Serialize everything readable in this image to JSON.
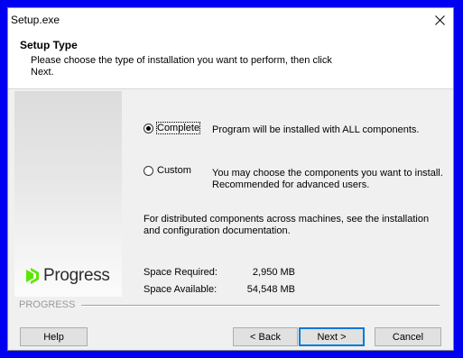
{
  "window": {
    "title": "Setup.exe"
  },
  "header": {
    "title": "Setup Type",
    "description": "Please choose the type of installation you want to perform, then click Next."
  },
  "banner": {
    "logo_text": "Progress"
  },
  "options": [
    {
      "label": "Complete",
      "selected": true,
      "description": "Program will be installed with  ALL components."
    },
    {
      "label": "Custom",
      "selected": false,
      "description": "You may choose the components you want to install. Recommended for advanced users."
    }
  ],
  "info": "For distributed components across machines, see the installation and configuration documentation.",
  "space": {
    "required_label": "Space Required:",
    "required_value": "2,950 MB",
    "available_label": "Space Available:",
    "available_value": "54,548 MB"
  },
  "footer": {
    "brand": "PROGRESS"
  },
  "buttons": {
    "help": "Help",
    "back": "< Back",
    "next": "Next >",
    "cancel": "Cancel"
  },
  "colors": {
    "desktop": "#0000f0",
    "logo_green": "#5ce500",
    "focus_blue": "#0078d7"
  }
}
